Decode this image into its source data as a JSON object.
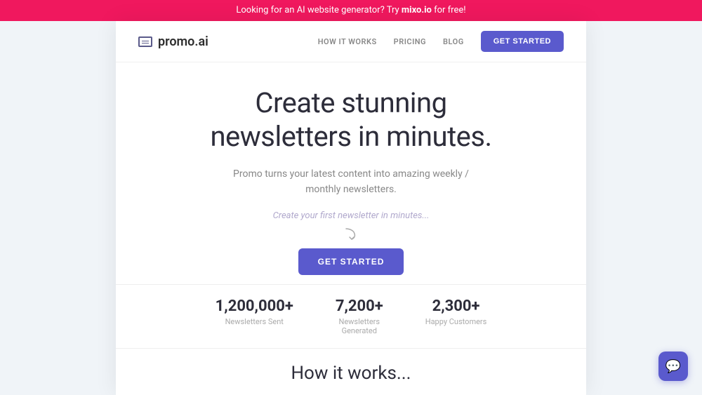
{
  "banner": {
    "text": "Looking for an AI website generator? Try ",
    "link_text": "mixo.io",
    "text_after": " for free!"
  },
  "navbar": {
    "logo_text": "promo.ai",
    "links": [
      {
        "label": "HOW IT WORKS",
        "id": "how-it-works"
      },
      {
        "label": "PRICING",
        "id": "pricing"
      },
      {
        "label": "BLOG",
        "id": "blog"
      }
    ],
    "cta_label": "GET STARTED"
  },
  "hero": {
    "title_line1": "Create stunning",
    "title_line2": "newsletters in minutes.",
    "subtitle": "Promo turns your latest content into amazing weekly / monthly newsletters.",
    "input_placeholder": "Create your first newsletter in minutes...",
    "cta_label": "GET STARTED"
  },
  "stats": [
    {
      "number": "1,200,000+",
      "label": "Newsletters Sent"
    },
    {
      "number": "7,200+",
      "label": "Newsletters\nGenerated"
    },
    {
      "number": "2,300+",
      "label": "Happy Customers"
    }
  ],
  "how_it_works": {
    "title": "How it works..."
  },
  "chat": {
    "icon": "💬"
  }
}
